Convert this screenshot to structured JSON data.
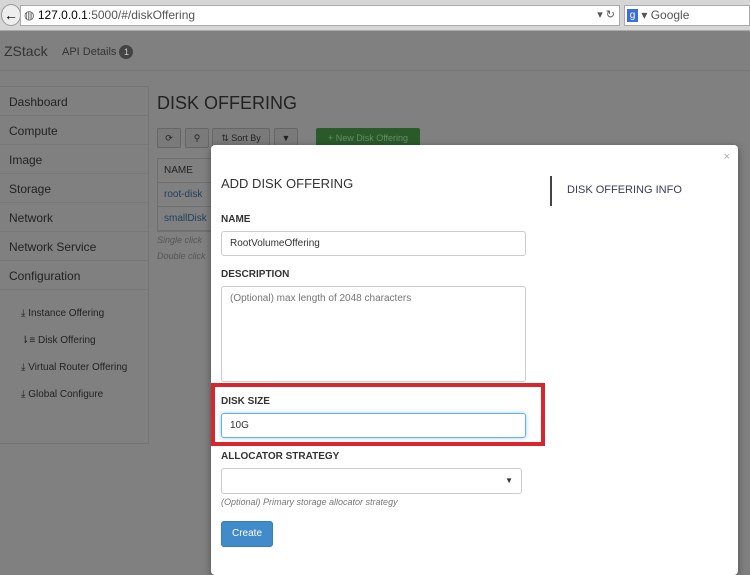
{
  "browser": {
    "url_host": "127.0.0.1",
    "url_rest": ":5000/#/diskOffering",
    "search_placeholder": "Google"
  },
  "header": {
    "brand": "ZStack",
    "api_details": "API Details",
    "api_count": "1"
  },
  "sidebar": {
    "items": [
      "Dashboard",
      "Compute",
      "Image",
      "Storage",
      "Network",
      "Network Service",
      "Configuration"
    ],
    "sub_items": [
      "Instance Offering",
      "Disk Offering",
      "Virtual Router Offering",
      "Global Configure"
    ]
  },
  "main": {
    "title": "DISK OFFERING",
    "sort_by": "Sort By",
    "new_button": "New Disk Offering",
    "table_header": "NAME",
    "rows": [
      "root-disk",
      "smallDisk"
    ],
    "hints": [
      "Single click",
      "Double click"
    ]
  },
  "modal": {
    "title": "ADD DISK OFFERING",
    "side_tab": "DISK OFFERING INFO",
    "close": "×",
    "name_label": "NAME",
    "name_value": "RootVolumeOffering",
    "description_label": "DESCRIPTION",
    "description_placeholder": "(Optional) max length of 2048 characters",
    "disk_size_label": "DISK SIZE",
    "disk_size_value": "10G",
    "allocator_label": "ALLOCATOR STRATEGY",
    "allocator_help": "(Optional) Primary storage allocator strategy",
    "create": "Create"
  },
  "colors": {
    "highlight": "#d7262d",
    "primary": "#428bca"
  }
}
